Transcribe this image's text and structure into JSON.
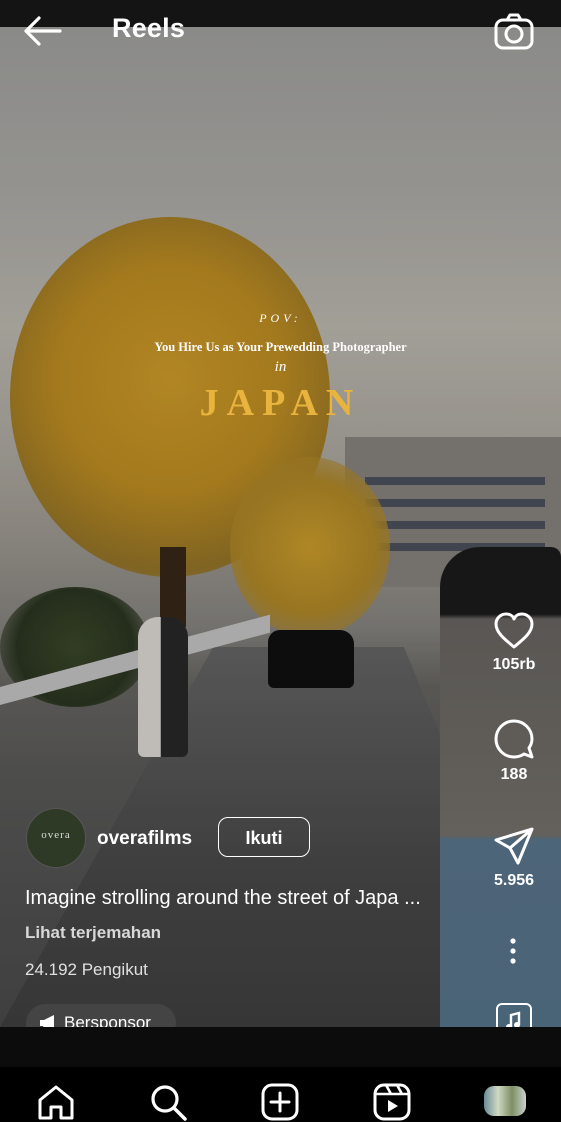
{
  "header": {
    "title": "Reels"
  },
  "video_overlay": {
    "pov": "POV:",
    "line": "You Hire Us as Your Prewedding Photographer",
    "in": "in",
    "location": "JAPAN",
    "location_color": "#e9b43d"
  },
  "actions": {
    "likes": "105rb",
    "comments": "188",
    "shares": "5.956"
  },
  "post": {
    "avatar_text": "overa",
    "username": "overafilms",
    "follow_label": "Ikuti",
    "caption": "Imagine strolling around the street of Japa ...",
    "translate_label": "Lihat terjemahan",
    "followers": "24.192 Pengikut",
    "sponsor_label": "Bersponsor"
  },
  "icons": [
    "back-arrow-icon",
    "camera-icon",
    "heart-icon",
    "comment-icon",
    "share-icon",
    "more-icon",
    "music-icon",
    "megaphone-icon",
    "home-icon",
    "search-icon",
    "create-icon",
    "reels-icon",
    "profile-avatar"
  ]
}
